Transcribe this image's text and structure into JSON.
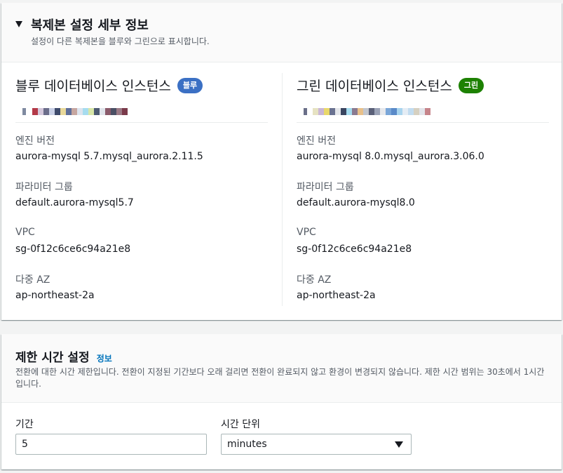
{
  "replica_panel": {
    "title": "복제본 설정 세부 정보",
    "description": "설정이 다른 복제본을 블루와 그린으로 표시합니다.",
    "blue": {
      "title": "블루 데이터베이스 인스턴스",
      "badge": "블루",
      "engine_label": "엔진 버전",
      "engine_value": "aurora-mysql 5.7.mysql_aurora.2.11.5",
      "param_label": "파라미터 그룹",
      "param_value": "default.aurora-mysql5.7",
      "vpc_label": "VPC",
      "vpc_value": "sg-0f12c6ce6c94a21e8",
      "az_label": "다중 AZ",
      "az_value": "ap-northeast-2a"
    },
    "green": {
      "title": "그린 데이터베이스 인스턴스",
      "badge": "그린",
      "engine_label": "엔진 버전",
      "engine_value": "aurora-mysql 8.0.mysql_aurora.3.06.0",
      "param_label": "파라미터 그룹",
      "param_value": "default.aurora-mysql8.0",
      "vpc_label": "VPC",
      "vpc_value": "sg-0f12c6ce6c94a21e8",
      "az_label": "다중 AZ",
      "az_value": "ap-northeast-2a"
    }
  },
  "timeout_panel": {
    "title": "제한 시간 설정",
    "info_link": "정보",
    "description": "전환에 대한 시간 제한입니다. 전환이 지정된 기간보다 오래 걸리면 전환이 완료되지 않고 환경이 변경되지 않습니다. 제한 시간 범위는 30초에서 1시간입니다.",
    "duration_label": "기간",
    "duration_value": "5",
    "unit_label": "시간 단위",
    "unit_value": "minutes"
  },
  "colors": {
    "badge_blue": "#3b70c4",
    "badge_green": "#1d8102",
    "link": "#0073bb"
  },
  "icons": {
    "collapse": "caret-down-icon",
    "dropdown": "triangle-down-icon"
  }
}
